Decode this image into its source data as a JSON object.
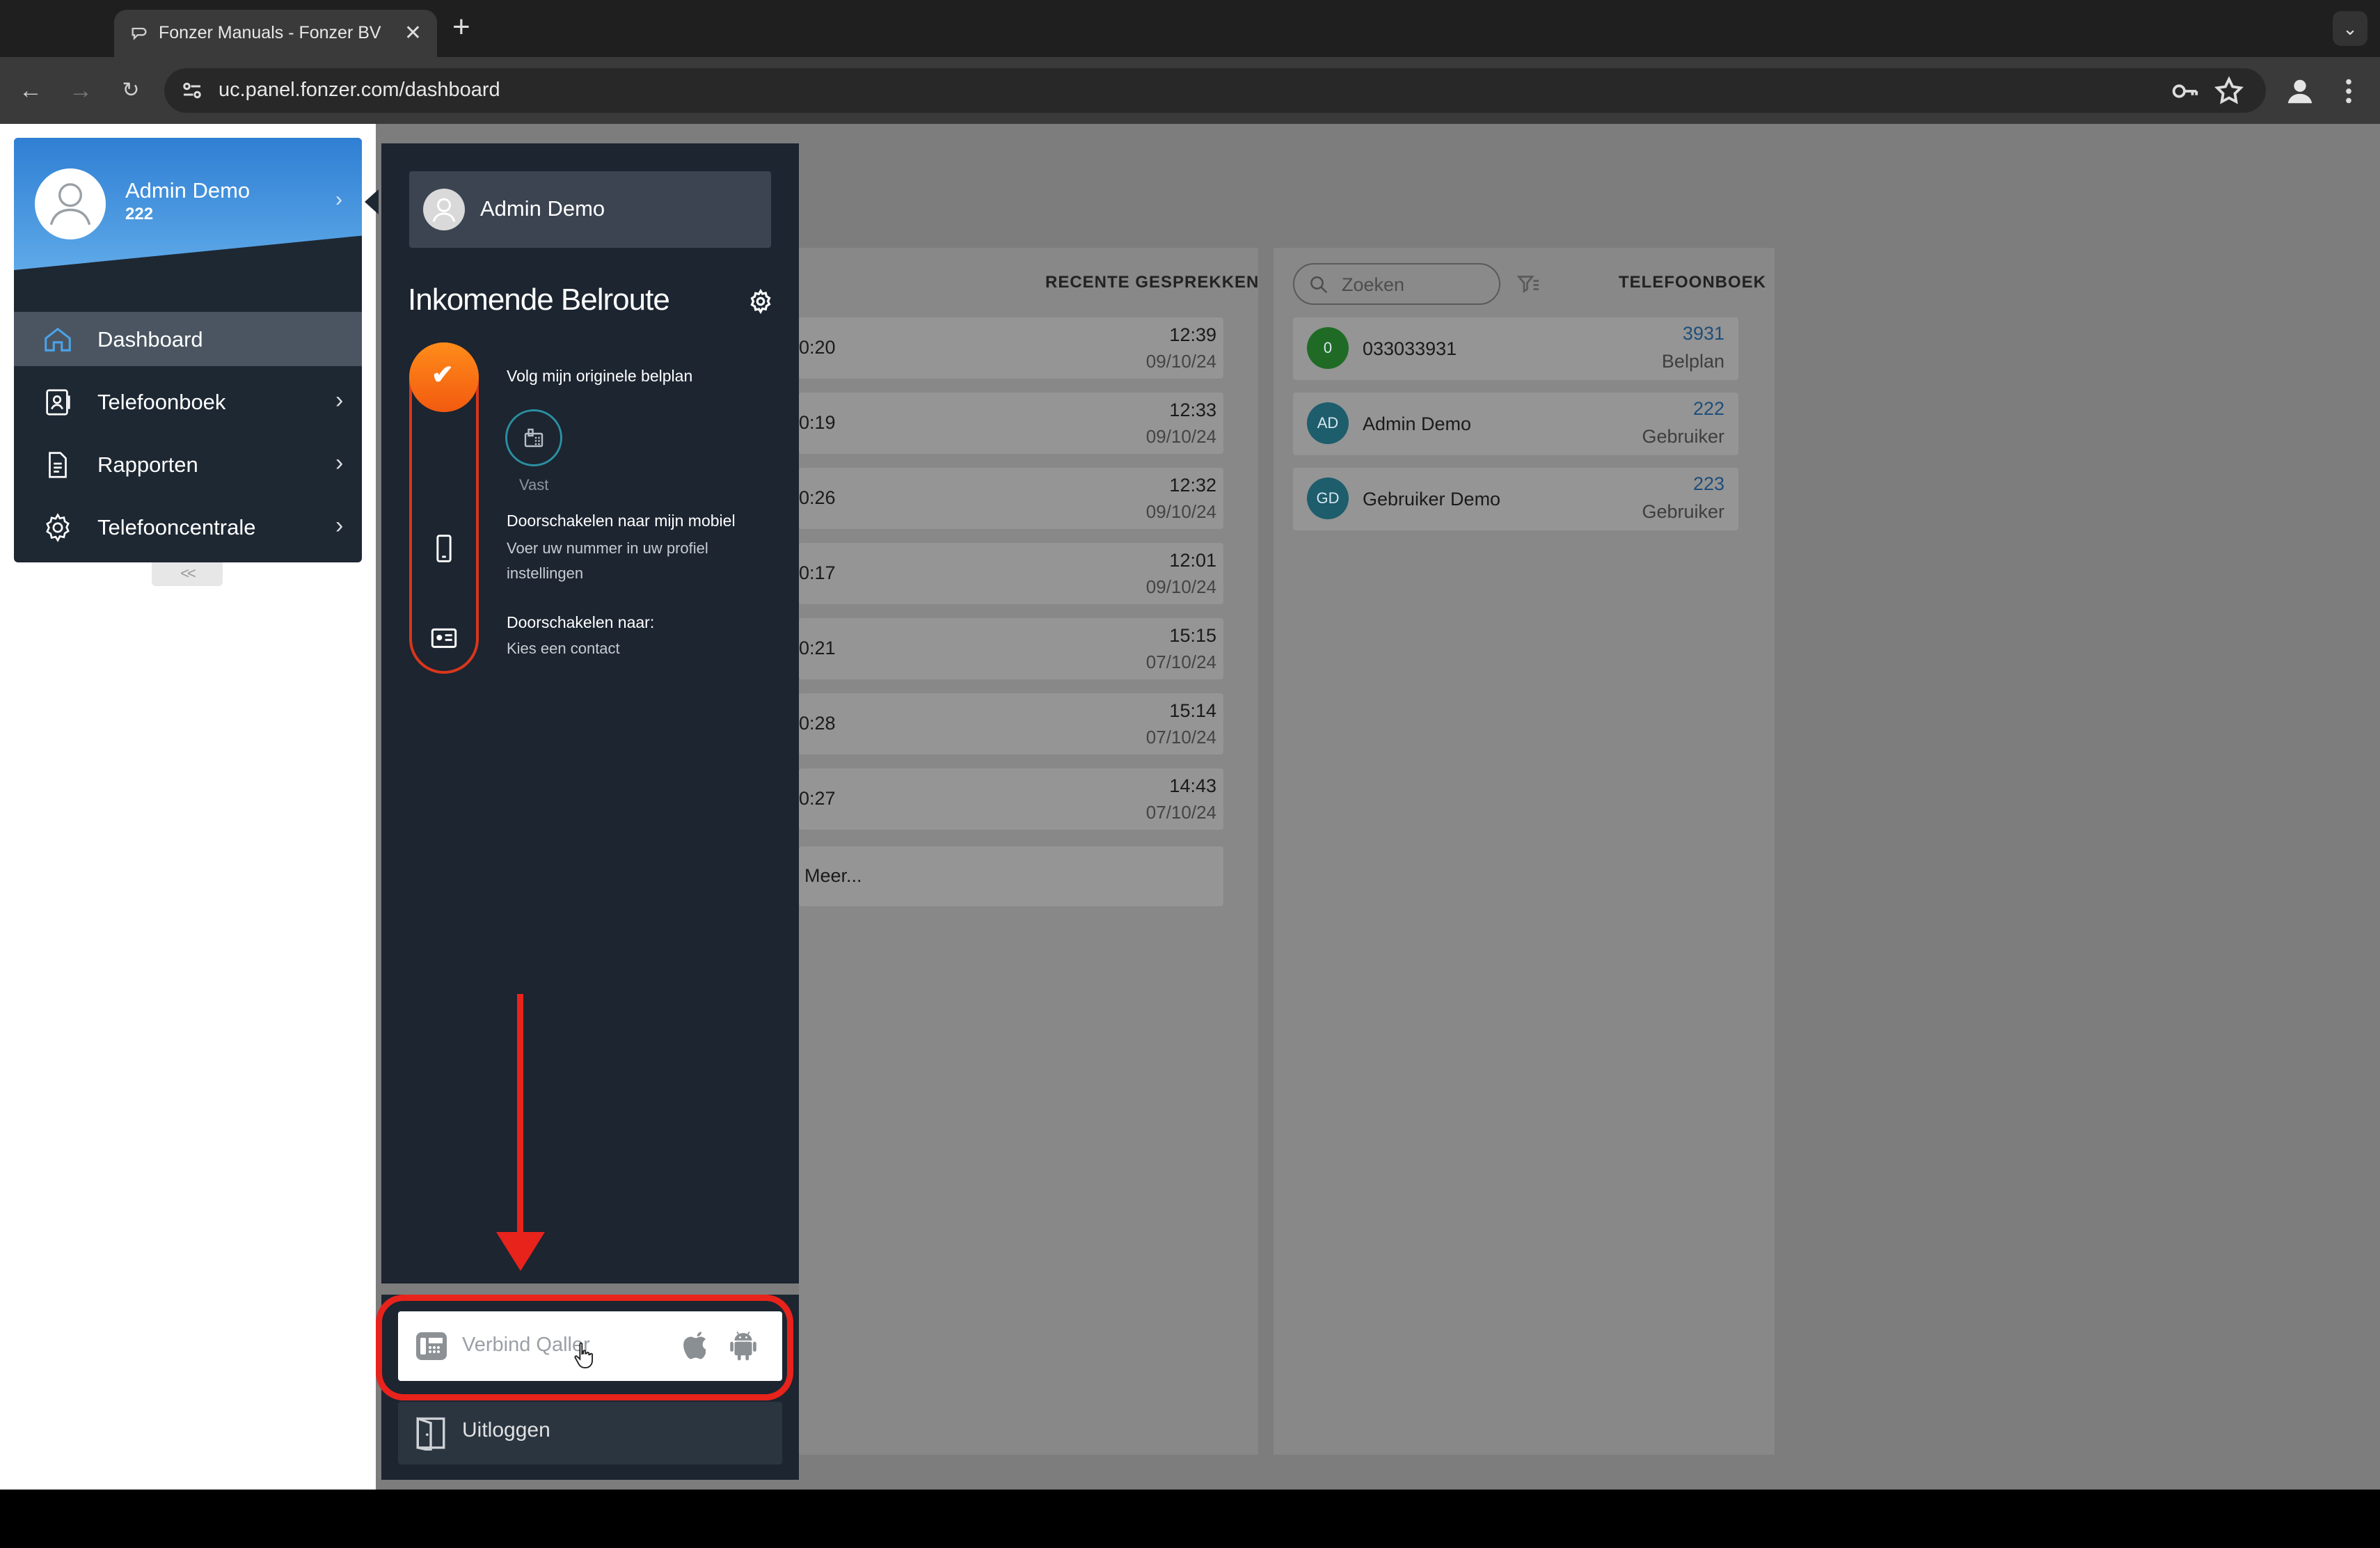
{
  "browser": {
    "tab_title": "Fonzer Manuals - Fonzer BV",
    "url": "uc.panel.fonzer.com/dashboard"
  },
  "sidebar": {
    "user_name": "Admin Demo",
    "user_extension": "222",
    "collapse_label": "<<",
    "items": [
      {
        "label": "Dashboard",
        "icon": "home-icon",
        "active": true
      },
      {
        "label": "Telefoonboek",
        "icon": "contact-book-icon"
      },
      {
        "label": "Rapporten",
        "icon": "document-icon"
      },
      {
        "label": "Telefooncentrale",
        "icon": "gear-icon"
      }
    ]
  },
  "panel": {
    "user_name": "Admin Demo",
    "route_title": "Inkomende Belroute",
    "steps": {
      "follow": "Volg mijn originele belplan",
      "vast_label": "Vast",
      "mobile_title": "Doorschakelen naar mijn mobiel",
      "mobile_sub": "Voer uw nummer in uw profiel instellingen",
      "forward_title": "Doorschakelen naar:",
      "forward_sub": "Kies een contact"
    },
    "qaller_label": "Verbind Qaller",
    "logout_label": "Uitloggen"
  },
  "recent_calls": {
    "header": "RECENTE GESPREKKEN",
    "rows": [
      {
        "duration": "0:20",
        "time": "12:39",
        "date": "09/10/24"
      },
      {
        "duration": "0:19",
        "time": "12:33",
        "date": "09/10/24"
      },
      {
        "duration": "0:26",
        "time": "12:32",
        "date": "09/10/24"
      },
      {
        "duration": "0:17",
        "time": "12:01",
        "date": "09/10/24"
      },
      {
        "duration": "0:21",
        "time": "15:15",
        "date": "07/10/24"
      },
      {
        "duration": "0:28",
        "time": "15:14",
        "date": "07/10/24"
      },
      {
        "duration": "0:27",
        "time": "14:43",
        "date": "07/10/24"
      }
    ],
    "more_label": "Meer..."
  },
  "phonebook": {
    "search_placeholder": "Zoeken",
    "header": "TELEFOONBOEK",
    "rows": [
      {
        "initials": "0",
        "name": "033033931",
        "number": "3931",
        "type": "Belplan",
        "color": "#1f8a2a"
      },
      {
        "initials": "AD",
        "name": "Admin Demo",
        "number": "222",
        "type": "Gebruiker",
        "color": "#1d6f82"
      },
      {
        "initials": "GD",
        "name": "Gebruiker Demo",
        "number": "223",
        "type": "Gebruiker",
        "color": "#1d6f82"
      }
    ]
  },
  "colors": {
    "accent_orange": "#f25a0f",
    "annotation_red": "#e8231c",
    "sidebar_bg": "#1e2833",
    "profile_blue": "#2f7fd4"
  }
}
